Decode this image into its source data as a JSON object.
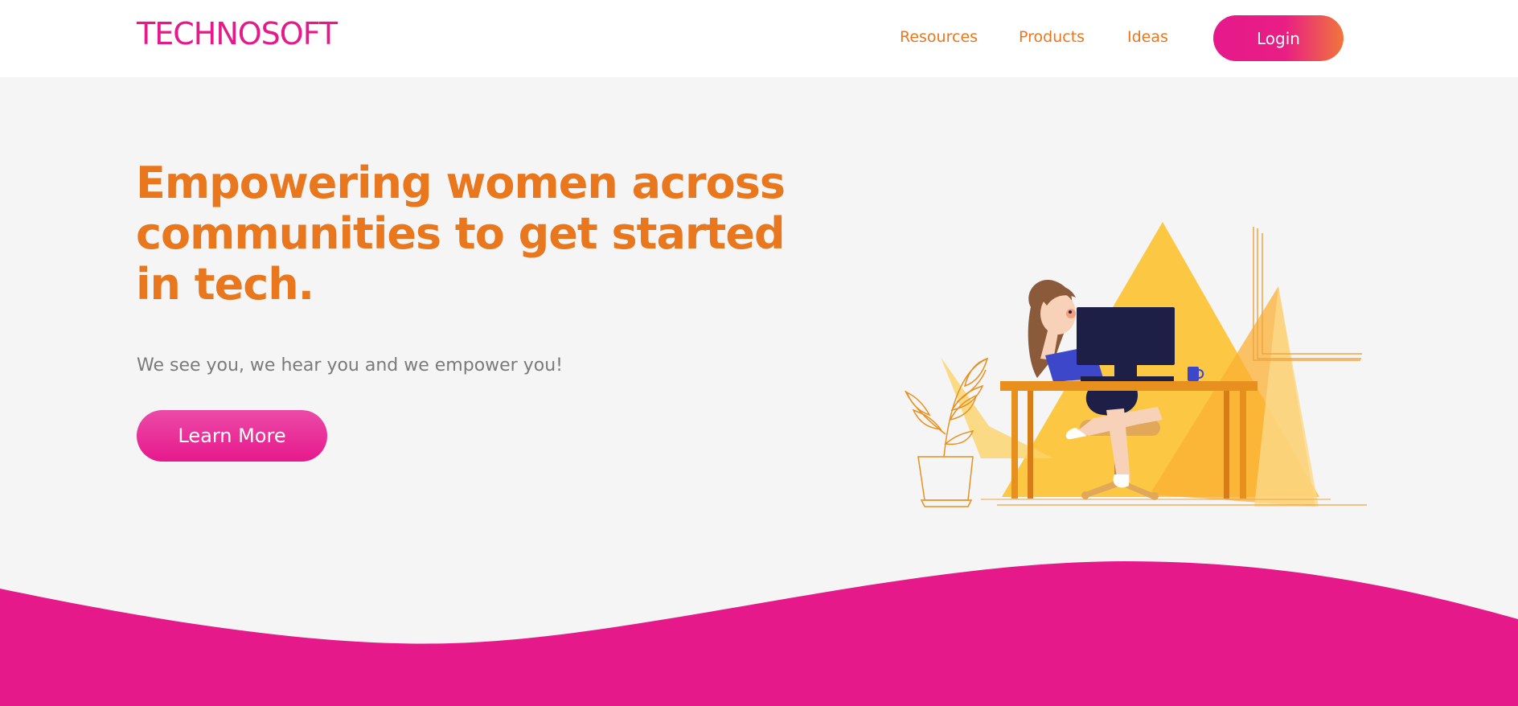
{
  "header": {
    "logo": "TECHNOSOFT",
    "nav": {
      "resources": "Resources",
      "products": "Products",
      "ideas": "Ideas"
    },
    "login_label": "Login"
  },
  "hero": {
    "title": "Empowering women across communities to get started in tech.",
    "subtitle": "We see you, we hear you and we empower you!",
    "cta_label": "Learn More"
  },
  "colors": {
    "brand_pink": "#e6198b",
    "accent_orange": "#e8771e",
    "background": "#f5f5f5",
    "illustration_yellow": "#fcc843",
    "monitor_navy": "#1e1f47"
  },
  "illustration": {
    "icon": "woman-at-desk-illustration"
  }
}
